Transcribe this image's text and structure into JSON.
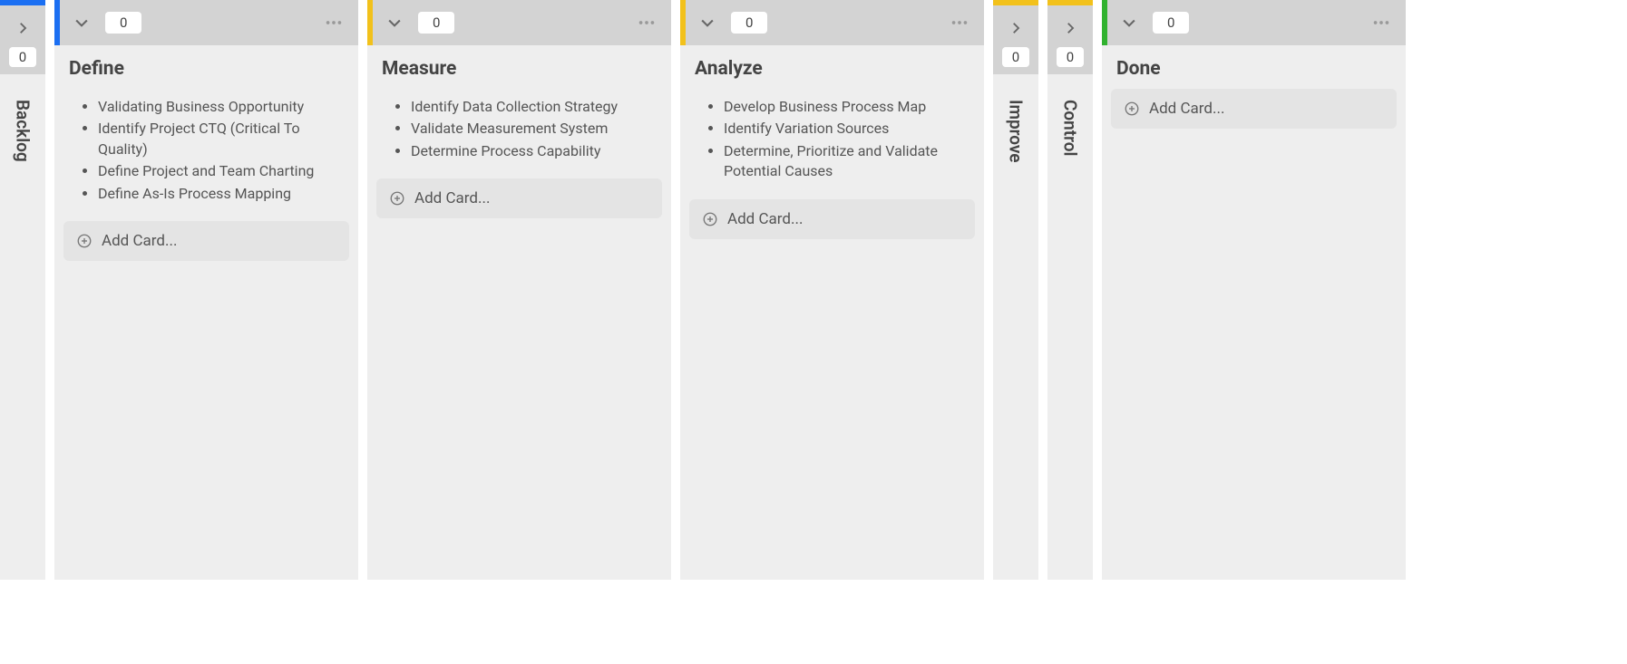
{
  "addCardLabel": "Add Card...",
  "columns": [
    {
      "id": "backlog",
      "title": "Backlog",
      "count": "0",
      "mode": "collapsed",
      "color": "#1b6ff2",
      "items": []
    },
    {
      "id": "define",
      "title": "Define",
      "count": "0",
      "mode": "expanded",
      "color": "#1b6ff2",
      "items": [
        "Validating Business Opportunity",
        "Identify Project CTQ (Critical To Quality)",
        "Define Project and Team Charting",
        "Define As-Is Process Mapping"
      ]
    },
    {
      "id": "measure",
      "title": "Measure",
      "count": "0",
      "mode": "expanded",
      "color": "#f2c11b",
      "items": [
        "Identify Data Collection Strategy",
        "Validate Measurement System",
        "Determine Process Capability"
      ]
    },
    {
      "id": "analyze",
      "title": "Analyze",
      "count": "0",
      "mode": "expanded",
      "color": "#f2c11b",
      "items": [
        "Develop Business Process Map",
        "Identify Variation Sources",
        "Determine, Prioritize and Validate Potential Causes"
      ]
    },
    {
      "id": "improve",
      "title": "Improve",
      "count": "0",
      "mode": "collapsed",
      "color": "#f2c11b",
      "items": []
    },
    {
      "id": "control",
      "title": "Control",
      "count": "0",
      "mode": "collapsed",
      "color": "#f2c11b",
      "items": []
    },
    {
      "id": "done",
      "title": "Done",
      "count": "0",
      "mode": "expanded",
      "color": "#31b22f",
      "items": []
    }
  ]
}
